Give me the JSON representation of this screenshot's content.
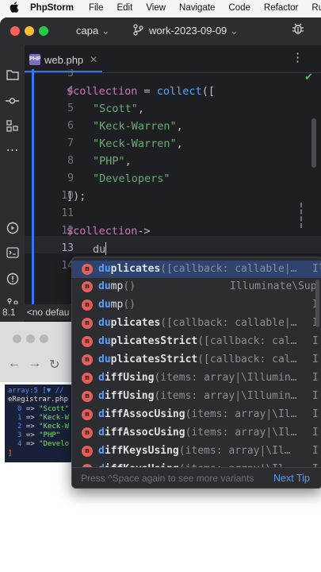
{
  "menubar": {
    "apple": "",
    "items": [
      "PhpStorm",
      "File",
      "Edit",
      "View",
      "Navigate",
      "Code",
      "Refactor",
      "Run"
    ]
  },
  "titlebar": {
    "project": "capa",
    "branch": "work-2023-09-09"
  },
  "tab": {
    "file": "web.php",
    "icon_text": "PHP"
  },
  "editor": {
    "line_numbers": [
      "3",
      "4",
      "5",
      "6",
      "7",
      "8",
      "9",
      "10",
      "11",
      "12",
      "13",
      "14"
    ],
    "code": {
      "l4_var": "$collection",
      "l4_eq": " = ",
      "l4_fn": "collect",
      "l4_open": "([",
      "l5": "\"Scott\"",
      "l6": "\"Keck-Warren\"",
      "l7": "\"Keck-Warren\"",
      "l8": "\"PHP\"",
      "l9": "\"Developers\"",
      "comma": ",",
      "l10": "]);",
      "l12_var": "$collection",
      "l12_arrow": "->",
      "l13": "du"
    }
  },
  "statusbar": {
    "left": "8.1",
    "text": "<no defau"
  },
  "dump": {
    "header": "array:5 [▼ //",
    "file": "eRegistrar.php",
    "items": [
      {
        "k": "0",
        "v": "\"Scott\""
      },
      {
        "k": "1",
        "v": "\"Keck-W"
      },
      {
        "k": "2",
        "v": "\"Keck-W"
      },
      {
        "k": "3",
        "v": "\"PHP\""
      },
      {
        "k": "4",
        "v": "\"Develo"
      }
    ],
    "close": "]"
  },
  "completion": {
    "icon_letter": "m",
    "items": [
      {
        "match": "du",
        "rest": "plicates",
        "params": "([callback: callable|…",
        "type": "Il"
      },
      {
        "match": "du",
        "rest": "mp",
        "params": "()",
        "type": "Illuminate\\Sup"
      },
      {
        "match": "du",
        "rest": "mp",
        "params": "()",
        "type": "I"
      },
      {
        "match": "du",
        "rest": "plicates",
        "params": "([callback: callable|…",
        "type": "I"
      },
      {
        "match": "du",
        "rest": "plicatesStrict",
        "params": "([callback: cal…",
        "type": "I"
      },
      {
        "match": "du",
        "rest": "plicatesStrict",
        "params": "([callback: cal…",
        "type": "I"
      },
      {
        "match": "d",
        "rest": "iffUsing",
        "params": "(items: array|\\Illumin…",
        "type": "I"
      },
      {
        "match": "d",
        "rest": "iffUsing",
        "params": "(items: array|\\Illumin…",
        "type": "I"
      },
      {
        "match": "d",
        "rest": "iffAssocUsing",
        "params": "(items: array|\\Il…",
        "type": "I"
      },
      {
        "match": "d",
        "rest": "iffAssocUsing",
        "params": "(items: array|\\Il…",
        "type": "I"
      },
      {
        "match": "d",
        "rest": "iffKeysUsing",
        "params": "(items: array|\\Il…",
        "type": "I"
      },
      {
        "match": "d",
        "rest": "iffKeysUsing",
        "params": "(items: array|\\Il…",
        "type": "I"
      }
    ],
    "footer_hint": "Press ^Space again to see more variants",
    "footer_link": "Next Tip"
  },
  "colors": {
    "accent": "#3574f0",
    "string": "#6aab73",
    "variable": "#c77dbb",
    "function": "#56a8f5",
    "method_icon": "#e45f5a",
    "selection": "#2e436e"
  }
}
